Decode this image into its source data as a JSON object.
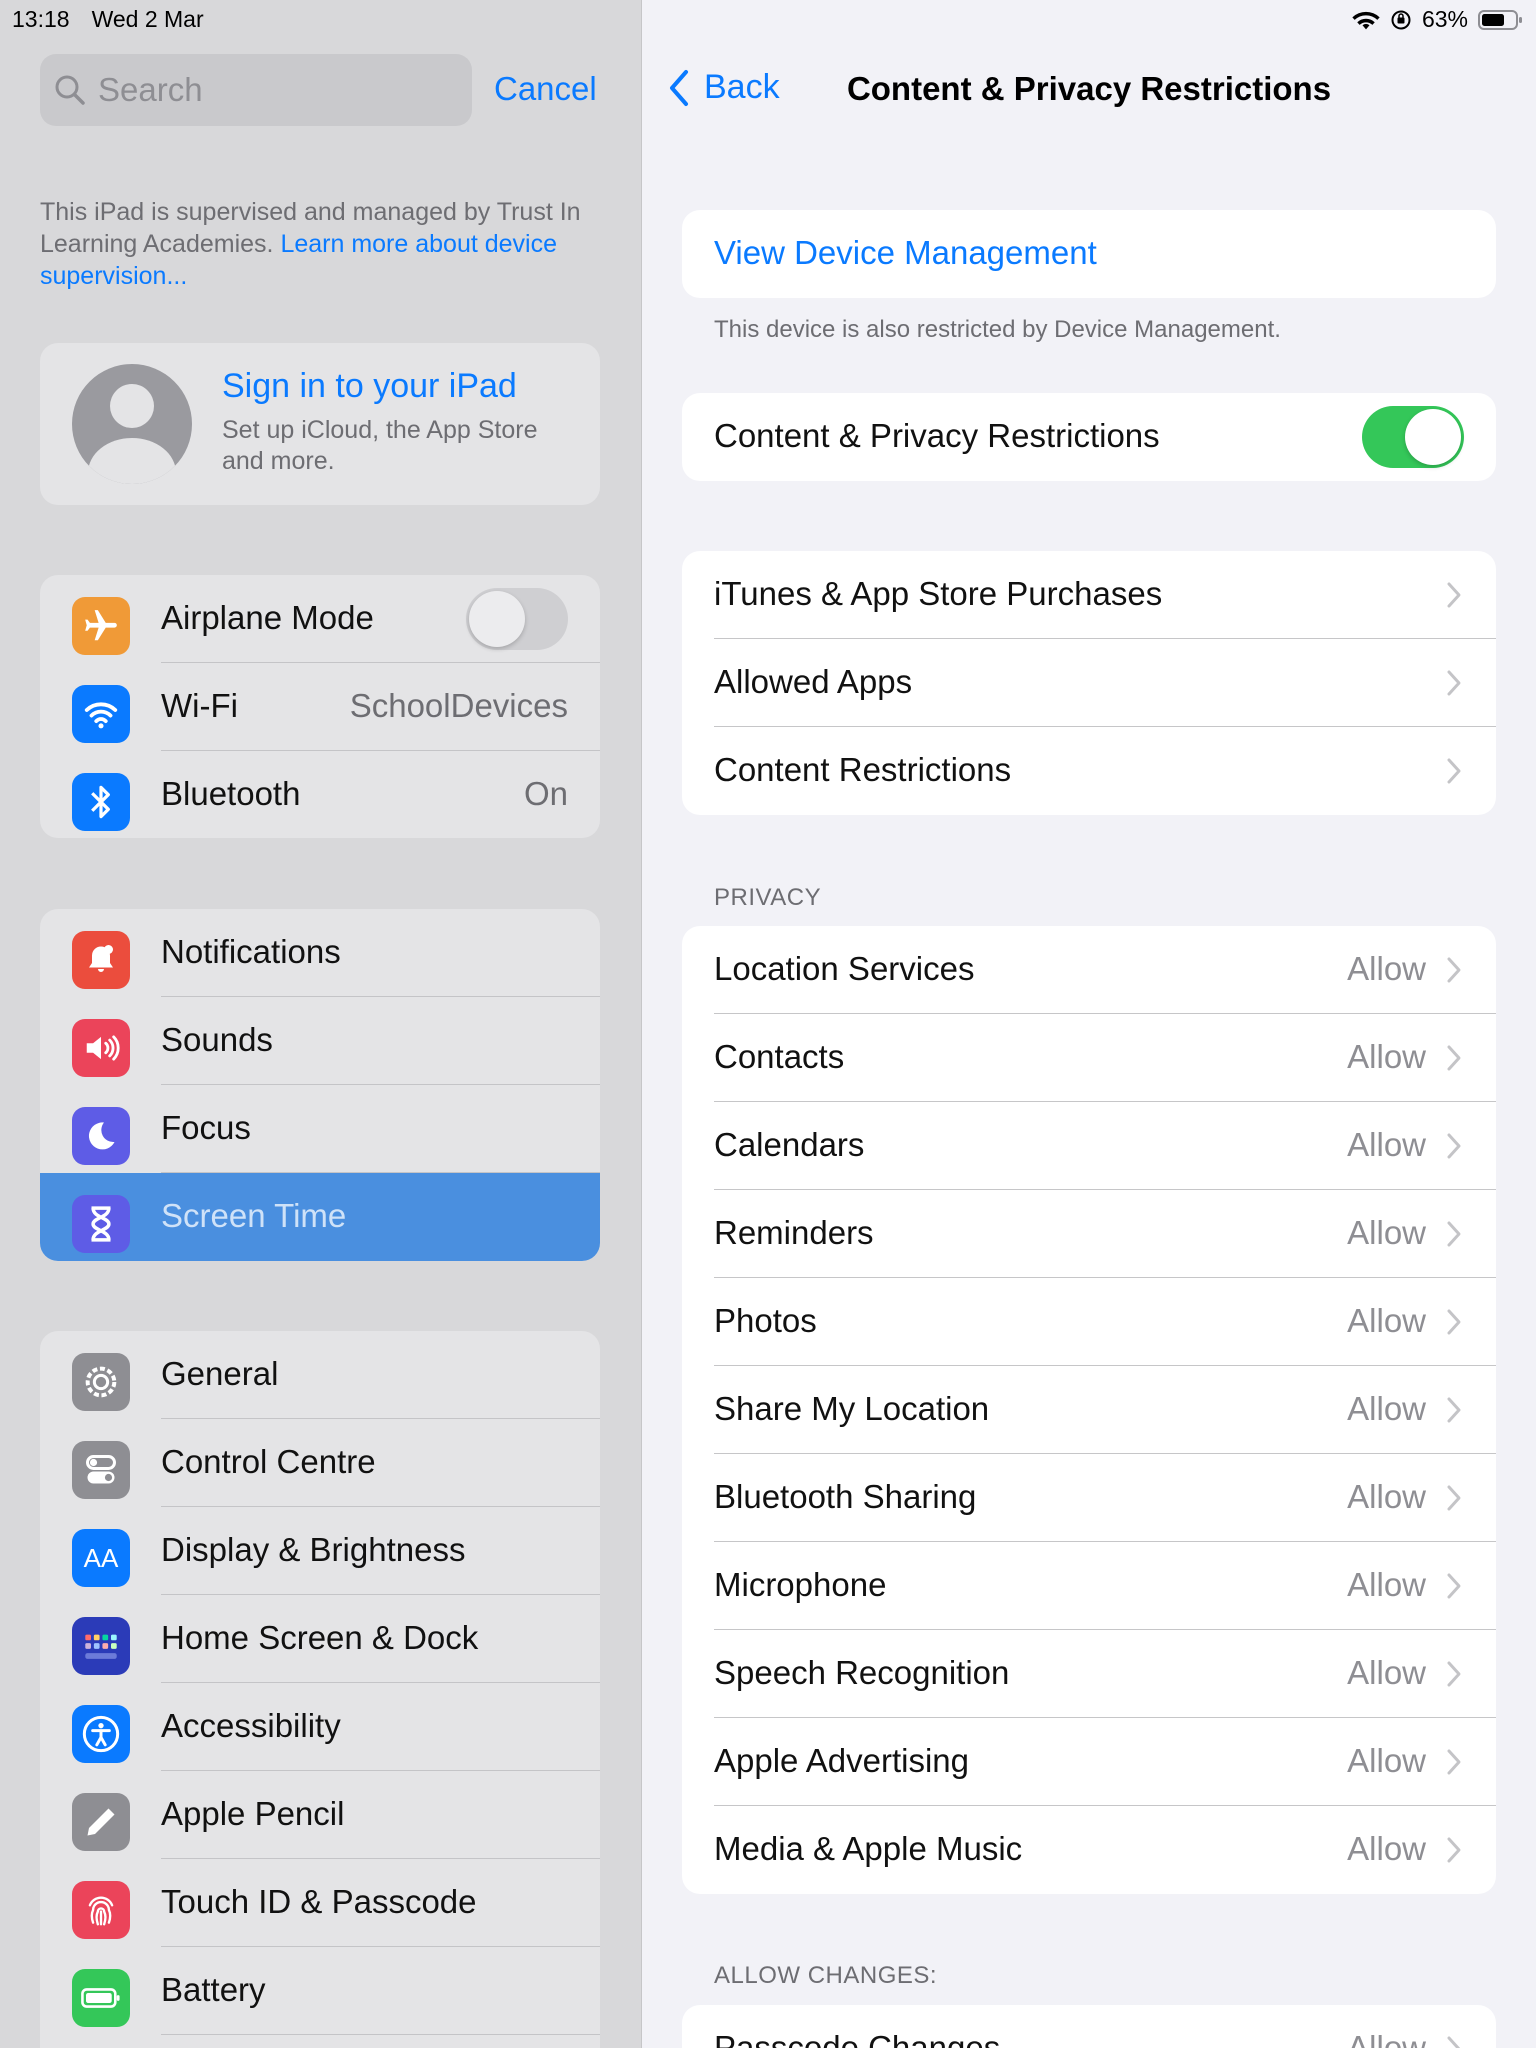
{
  "status_bar": {
    "time": "13:18",
    "date": "Wed 2 Mar",
    "battery": "63%"
  },
  "sidebar": {
    "search_placeholder": "Search",
    "cancel": "Cancel",
    "supervision_text": "This iPad is supervised and managed by Trust In Learning Academies.",
    "supervision_link": "Learn more about device supervision...",
    "signin_title": "Sign in to your iPad",
    "signin_sub": "Set up iCloud, the App Store and more.",
    "group1": [
      {
        "label": "Airplane Mode",
        "value": "",
        "icon": "airplane-icon",
        "color": "#f09a37"
      },
      {
        "label": "Wi-Fi",
        "value": "SchoolDevices",
        "icon": "wifi-icon",
        "color": "#0a7aff"
      },
      {
        "label": "Bluetooth",
        "value": "On",
        "icon": "bluetooth-icon",
        "color": "#0a7aff"
      }
    ],
    "group2": [
      {
        "label": "Notifications",
        "icon": "notifications-icon",
        "color": "#eb4d3d"
      },
      {
        "label": "Sounds",
        "icon": "sounds-icon",
        "color": "#eb445a"
      },
      {
        "label": "Focus",
        "icon": "focus-moon-icon",
        "color": "#5e5ce6"
      },
      {
        "label": "Screen Time",
        "icon": "hourglass-icon",
        "color": "#5e5ce6"
      }
    ],
    "group3": [
      {
        "label": "General",
        "icon": "gear-icon",
        "color": "#8e8e93"
      },
      {
        "label": "Control Centre",
        "icon": "control-centre-icon",
        "color": "#8e8e93"
      },
      {
        "label": "Display & Brightness",
        "icon": "display-icon",
        "color": "#0a7aff"
      },
      {
        "label": "Home Screen & Dock",
        "icon": "home-screen-icon",
        "color": "#2b3bb8"
      },
      {
        "label": "Accessibility",
        "icon": "accessibility-icon",
        "color": "#0a7aff"
      },
      {
        "label": "Apple Pencil",
        "icon": "pencil-icon",
        "color": "#8e8e93"
      },
      {
        "label": "Touch ID & Passcode",
        "icon": "fingerprint-icon",
        "color": "#eb445a"
      },
      {
        "label": "Battery",
        "icon": "battery-icon",
        "color": "#34c759"
      }
    ]
  },
  "detail": {
    "back": "Back",
    "title": "Content & Privacy Restrictions",
    "view_device_management": "View Device Management",
    "dm_note": "This device is also restricted by Device Management.",
    "main_toggle_label": "Content & Privacy Restrictions",
    "store_rows": [
      "iTunes & App Store Purchases",
      "Allowed Apps",
      "Content Restrictions"
    ],
    "privacy_header": "PRIVACY",
    "privacy_rows": [
      {
        "label": "Location Services",
        "value": "Allow"
      },
      {
        "label": "Contacts",
        "value": "Allow"
      },
      {
        "label": "Calendars",
        "value": "Allow"
      },
      {
        "label": "Reminders",
        "value": "Allow"
      },
      {
        "label": "Photos",
        "value": "Allow"
      },
      {
        "label": "Share My Location",
        "value": "Allow"
      },
      {
        "label": "Bluetooth Sharing",
        "value": "Allow"
      },
      {
        "label": "Microphone",
        "value": "Allow"
      },
      {
        "label": "Speech Recognition",
        "value": "Allow"
      },
      {
        "label": "Apple Advertising",
        "value": "Allow"
      },
      {
        "label": "Media & Apple Music",
        "value": "Allow"
      }
    ],
    "allow_changes_header": "ALLOW CHANGES:",
    "allow_changes_rows": [
      {
        "label": "Passcode Changes",
        "value": "Allow"
      }
    ]
  }
}
